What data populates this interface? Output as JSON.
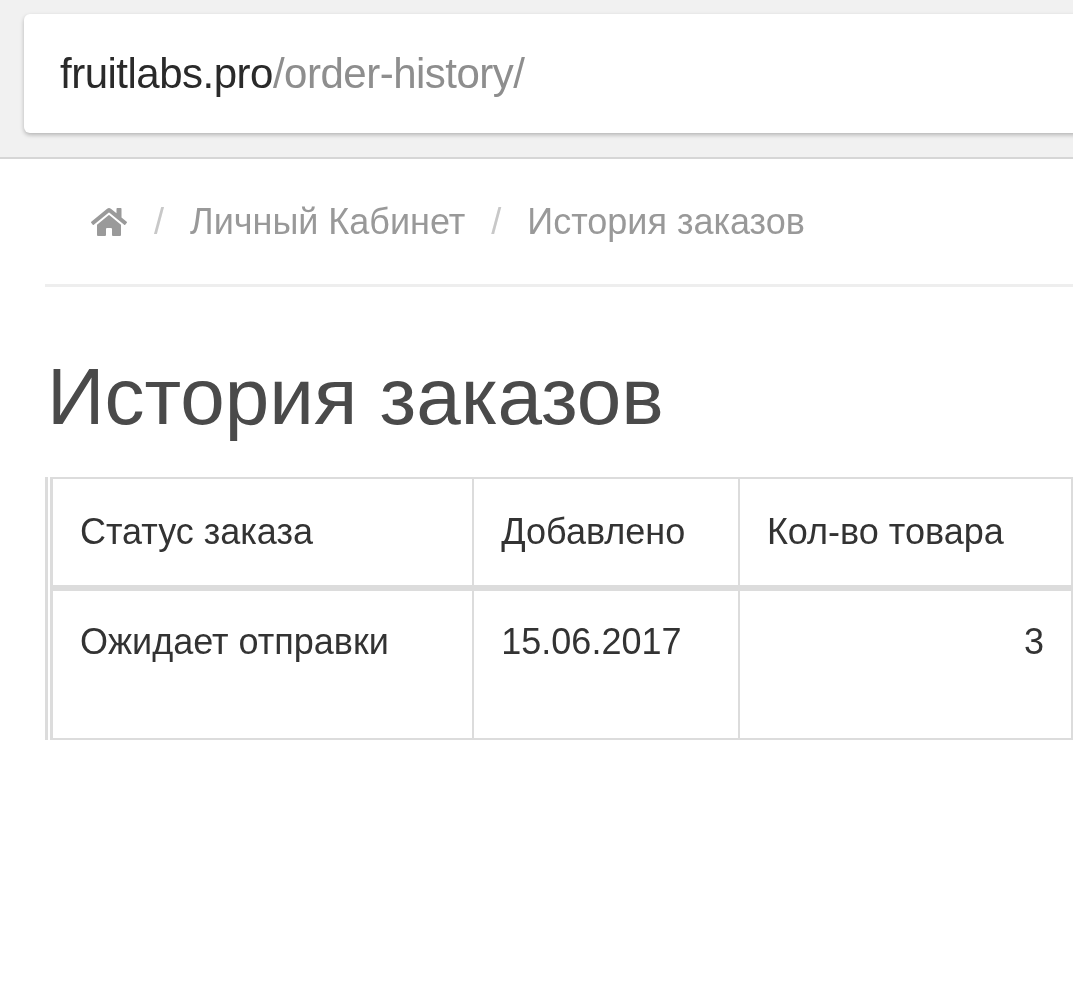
{
  "address_bar": {
    "domain": "fruitlabs.pro",
    "path": "/order-history/"
  },
  "breadcrumb": [
    {
      "separator": "/",
      "label": "Личный Кабинет"
    },
    {
      "separator": "/",
      "label": "История заказов"
    }
  ],
  "heading": "История заказов",
  "table": {
    "columns": [
      "Статус заказа",
      "Добавлено",
      "Кол-во товара"
    ],
    "rows": [
      [
        "Ожидает отправки",
        "15.06.2017",
        "3"
      ]
    ]
  }
}
